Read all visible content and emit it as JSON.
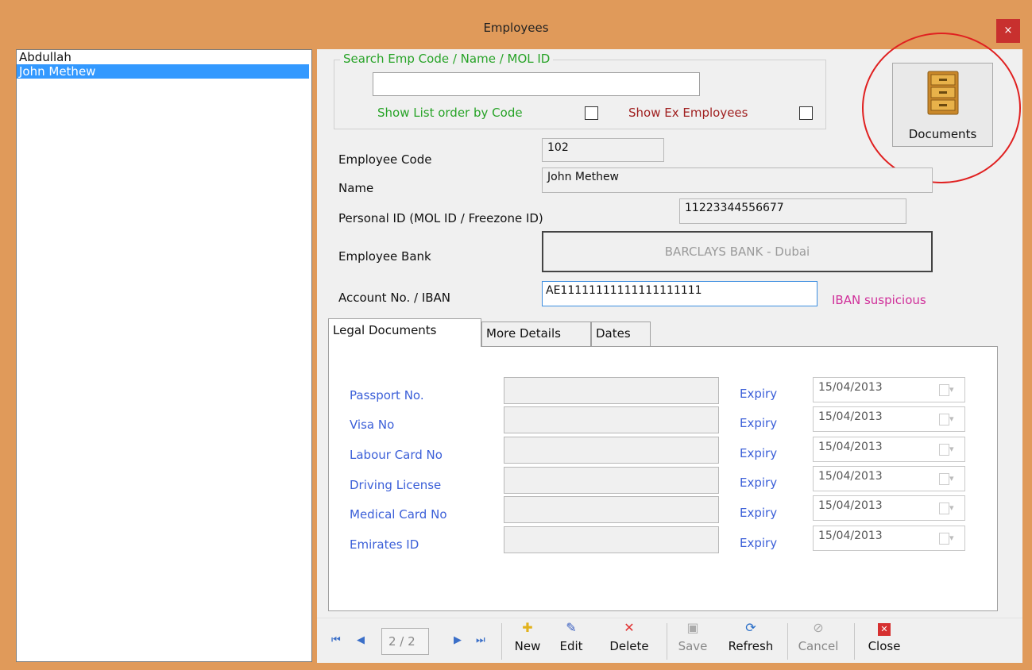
{
  "window": {
    "title": "Employees",
    "close_label": "×"
  },
  "employee_list": [
    "Abdullah",
    "John Methew"
  ],
  "search": {
    "legend": "Search Emp Code / Name / MOL ID",
    "value": "",
    "show_order_by_code_label": "Show List order by Code",
    "show_ex_employees_label": "Show Ex Employees"
  },
  "documents_button": {
    "label": "Documents",
    "icon": "filing-cabinet-icon"
  },
  "fields": {
    "code_label": "Employee Code",
    "code_value": "102",
    "name_label": "Name",
    "name_value": "John Methew",
    "personal_id_label": "Personal ID (MOL ID / Freezone ID)",
    "personal_id_value": "11223344556677",
    "bank_label": "Employee Bank",
    "bank_value": "BARCLAYS BANK - Dubai",
    "iban_label": "Account No. / IBAN",
    "iban_value": "AE11111111111111111111",
    "iban_warning": "IBAN suspicious"
  },
  "tabs": [
    {
      "label": "Legal Documents",
      "active": true
    },
    {
      "label": "More Details",
      "active": false
    },
    {
      "label": "Dates",
      "active": false
    }
  ],
  "legal_documents": [
    {
      "label": "Passport No.",
      "expiry_label": "Expiry",
      "expiry": "15/04/2013"
    },
    {
      "label": "Visa No",
      "expiry_label": "Expiry",
      "expiry": "15/04/2013"
    },
    {
      "label": "Labour Card No",
      "expiry_label": "Expiry",
      "expiry": "15/04/2013"
    },
    {
      "label": "Driving License",
      "expiry_label": "Expiry",
      "expiry": "15/04/2013"
    },
    {
      "label": "Medical Card No",
      "expiry_label": "Expiry",
      "expiry": "15/04/2013"
    },
    {
      "label": "Emirates ID",
      "expiry_label": "Expiry",
      "expiry": "15/04/2013"
    }
  ],
  "toolbar": {
    "page_indicator": "2 / 2",
    "buttons": [
      {
        "label": "New",
        "icon": "plus-icon",
        "enabled": true
      },
      {
        "label": "Edit",
        "icon": "pencil-icon",
        "enabled": true
      },
      {
        "label": "Delete",
        "icon": "x-icon",
        "enabled": true
      },
      {
        "label": "Save",
        "icon": "floppy-icon",
        "enabled": false
      },
      {
        "label": "Refresh",
        "icon": "refresh-icon",
        "enabled": true
      },
      {
        "label": "Cancel",
        "icon": "cancel-icon",
        "enabled": false
      },
      {
        "label": "Close",
        "icon": "close-box-icon",
        "enabled": true
      }
    ]
  },
  "colors": {
    "title_bg": "#e09a5a",
    "accent_green": "#27a327",
    "selection": "#3399ff",
    "warning": "#d0309a",
    "doc_label": "#3b5fd8"
  }
}
